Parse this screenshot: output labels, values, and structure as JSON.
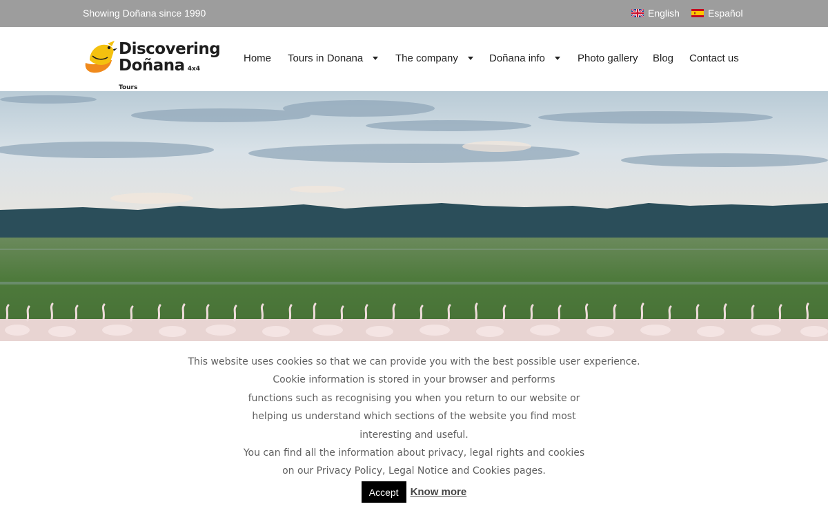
{
  "topbar": {
    "tagline": "Showing Doñana since 1990",
    "languages": [
      {
        "label": "English",
        "flag": "uk-flag-icon"
      },
      {
        "label": "Español",
        "flag": "spain-flag-icon"
      }
    ]
  },
  "logo": {
    "line1": "Discovering",
    "line2": "Doñana",
    "sub": "4x4 Tours",
    "icon": "bird-logo-icon",
    "colors": {
      "bird_yellow": "#f4c10f",
      "bird_orange": "#f08a1c"
    }
  },
  "nav": {
    "items": [
      {
        "label": "Home",
        "has_dropdown": false
      },
      {
        "label": "Tours in Donana",
        "has_dropdown": true
      },
      {
        "label": "The company",
        "has_dropdown": true
      },
      {
        "label": "Doñana info",
        "has_dropdown": true
      },
      {
        "label": "Photo gallery",
        "has_dropdown": false
      },
      {
        "label": "Blog",
        "has_dropdown": false
      },
      {
        "label": "Contact us",
        "has_dropdown": false
      }
    ]
  },
  "cookie": {
    "lines": [
      "This website uses cookies so that we can provide you with the best possible user experience.",
      "Cookie information is stored in your browser and performs",
      "functions such as recognising you when you return to our website or",
      "helping us understand which sections of the website you find most",
      "interesting and useful.",
      "You can find all the information about privacy, legal rights and cookies",
      "on our Privacy Policy, Legal Notice and Cookies pages."
    ],
    "accept_label": "Accept",
    "more_label": "Know more"
  },
  "colors": {
    "topbar_bg": "#9d9d9d",
    "accept_bg": "#000000"
  }
}
